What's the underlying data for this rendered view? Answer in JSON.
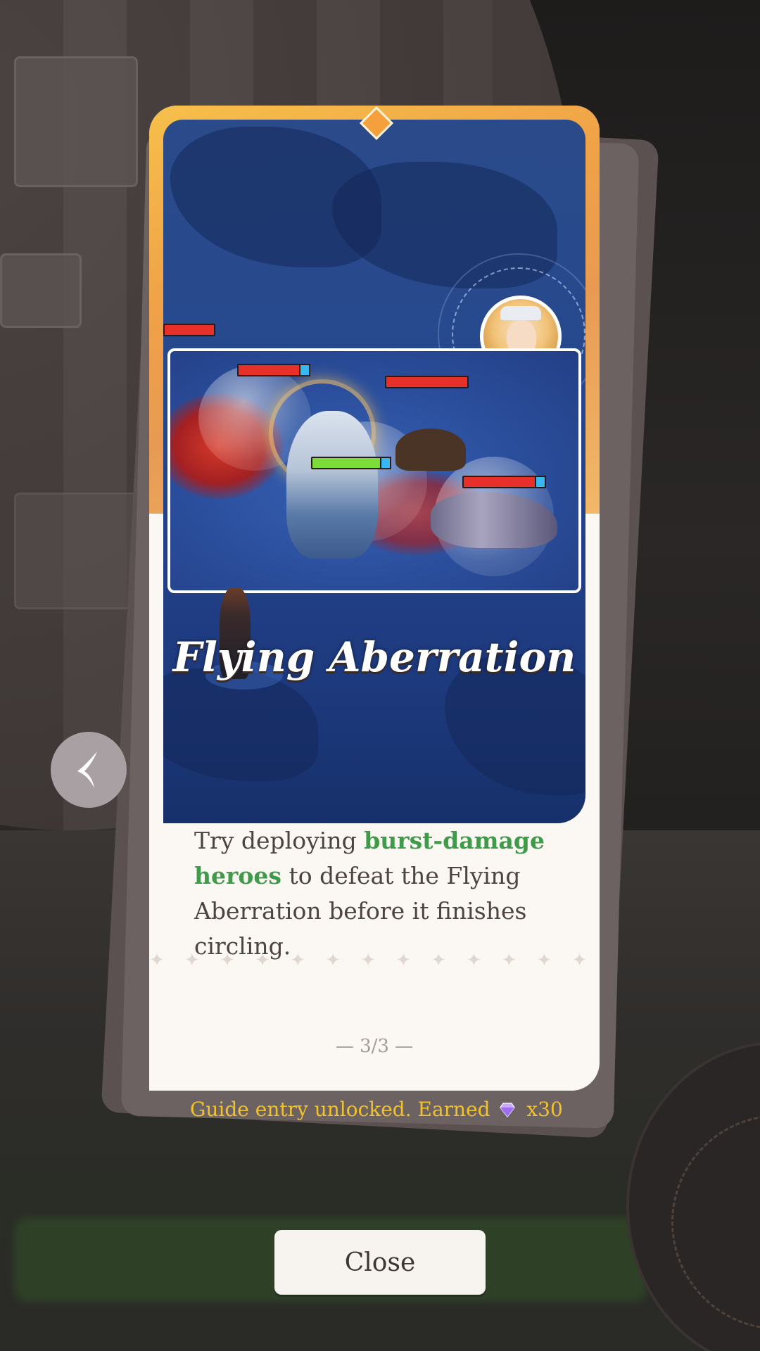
{
  "card": {
    "title": "Flying Aberration",
    "description_parts": {
      "p1": "Try deploying ",
      "highlight": "burst-damage heroes",
      "p2": " to defeat the Flying Aberration before it finishes circling."
    },
    "page_indicator": "— 3/3 —"
  },
  "reward": {
    "text": "Guide entry unlocked. Earned",
    "icon": "diamond-icon",
    "amount": "x30"
  },
  "buttons": {
    "prev_icon": "chevron-left-icon",
    "close_label": "Close"
  },
  "colors": {
    "highlight": "#3f9a4a",
    "reward_text": "#f2c12e",
    "card_frame": "#f0a247"
  }
}
